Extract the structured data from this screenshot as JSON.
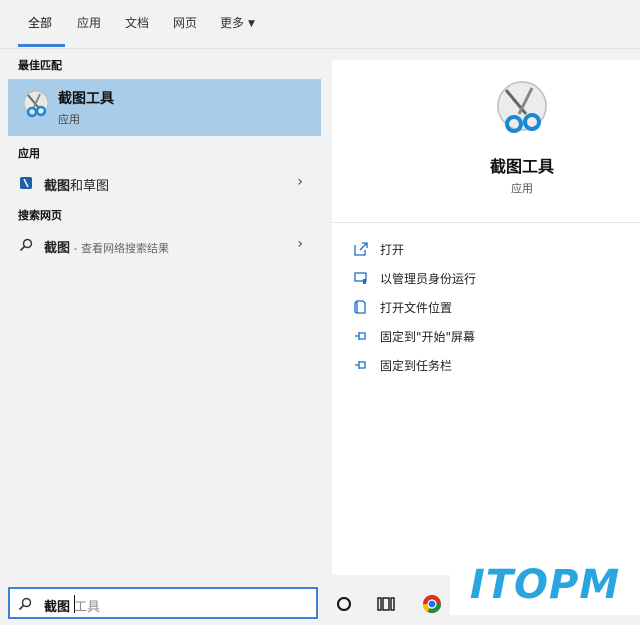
{
  "tabs": [
    "全部",
    "应用",
    "文档",
    "网页",
    "更多"
  ],
  "sections": {
    "best_match": "最佳匹配",
    "apps": "应用",
    "web": "搜索网页"
  },
  "best_match_item": {
    "title": "截图工具",
    "subtitle": "应用"
  },
  "app_item": {
    "bold": "截图",
    "rest": "和草图"
  },
  "web_item": {
    "bold": "截图",
    "hint": " - 查看网络搜索结果"
  },
  "detail": {
    "title": "截图工具",
    "type": "应用",
    "actions": [
      "打开",
      "以管理员身份运行",
      "打开文件位置",
      "固定到\"开始\"屏幕",
      "固定到任务栏"
    ]
  },
  "search": {
    "typed": "截图",
    "suggestion": "工具"
  },
  "watermark": "ITOPM",
  "colors": {
    "accent": "#3b82d6",
    "selected": "#a9cde8",
    "watermark": "#2aa5df"
  }
}
